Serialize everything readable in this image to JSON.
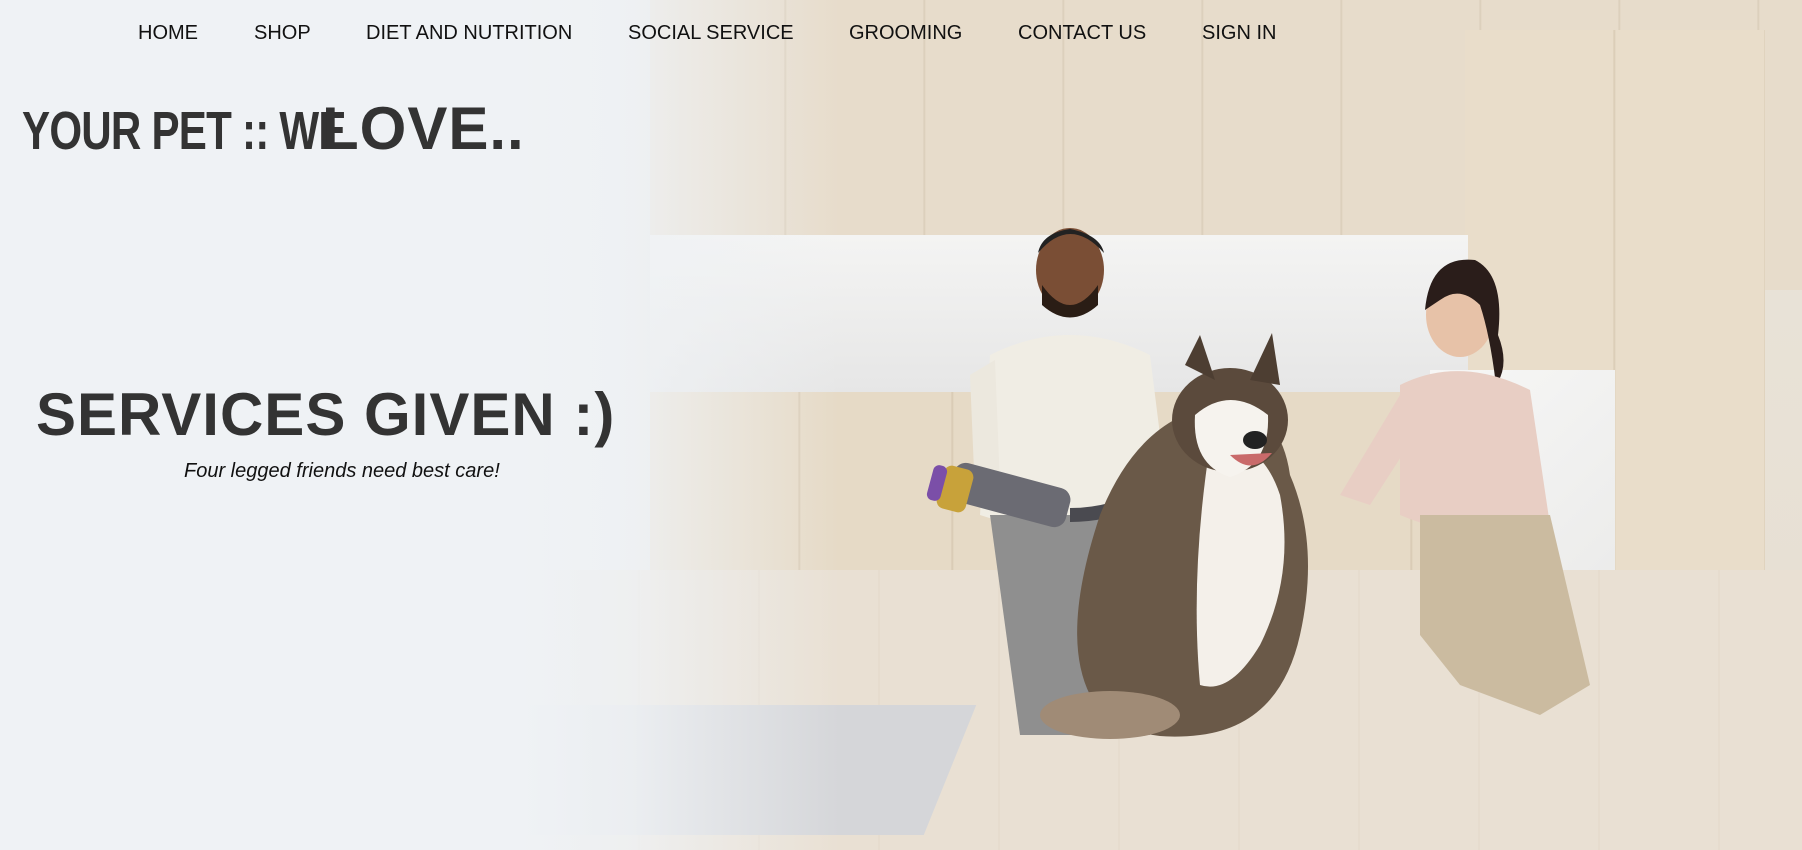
{
  "nav": {
    "items": [
      {
        "label": "HOME"
      },
      {
        "label": "SHOP"
      },
      {
        "label": "DIET AND NUTRITION"
      },
      {
        "label": "SOCIAL SERVICE"
      },
      {
        "label": "GROOMING"
      },
      {
        "label": "CONTACT US"
      },
      {
        "label": "SIGN IN"
      }
    ]
  },
  "hero": {
    "tagline_part_a": "YOUR PET :: WE",
    "tagline_part_b": "LOVE..",
    "services_title": "SERVICES GIVEN :)",
    "services_subtitle": "Four legged friends need best care!"
  },
  "colors": {
    "page_background": "#eff2f5",
    "heading_text": "#333333",
    "nav_text": "#111111"
  }
}
